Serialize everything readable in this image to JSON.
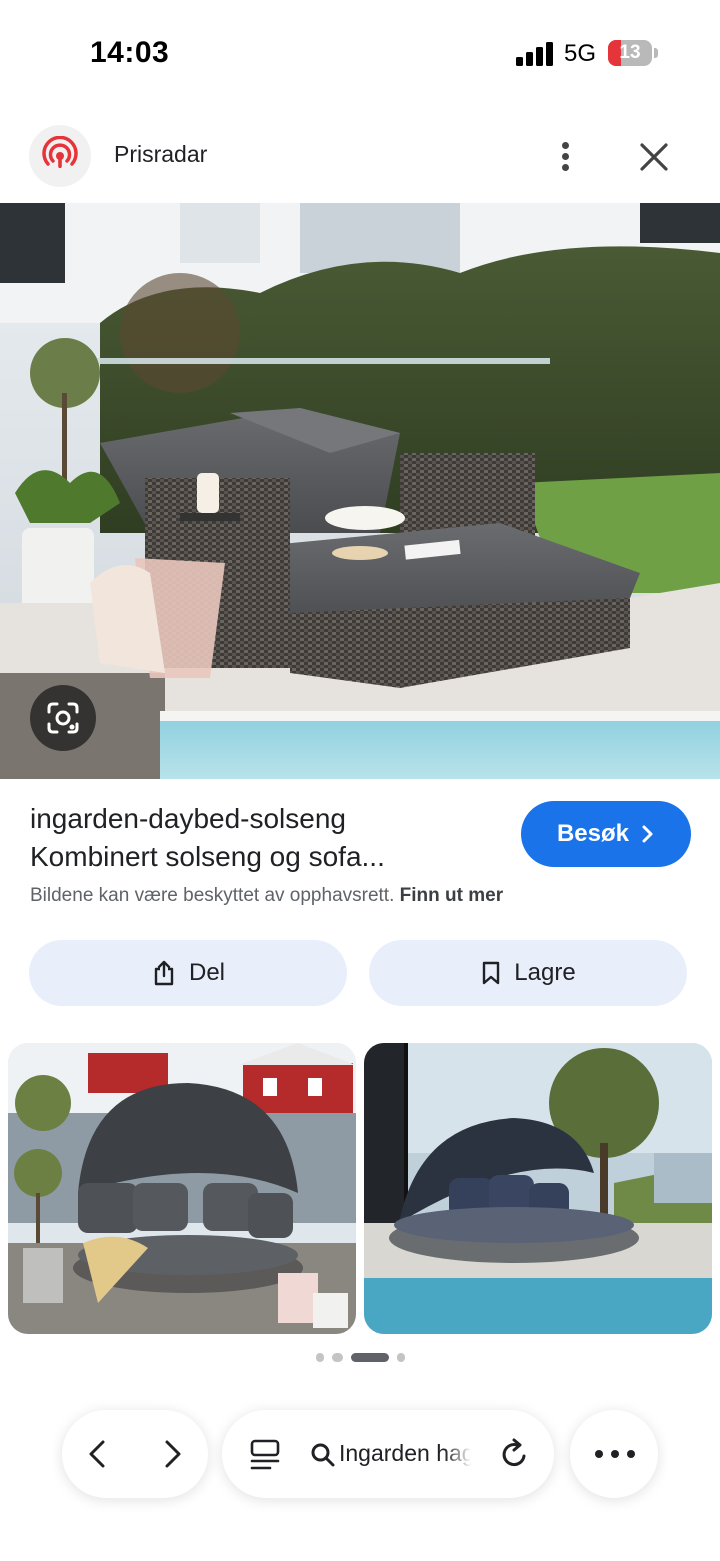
{
  "status_bar": {
    "time": "14:03",
    "network": "5G",
    "battery_level": "13"
  },
  "header": {
    "site_name": "Prisradar",
    "logo_icon": "prisradar-logo",
    "menu_icon": "more-vert-icon",
    "close_icon": "close-icon"
  },
  "main_image": {
    "description_icon": "lens-icon"
  },
  "result": {
    "title_line1": "ingarden-daybed-solseng",
    "title_line2": "Kombinert solseng og sofa...",
    "visit_label": "Besøk",
    "copyright_text": "Bildene kan være beskyttet av opphavsrett.",
    "learn_more": "Finn ut mer"
  },
  "actions": {
    "share_label": "Del",
    "save_label": "Lagre"
  },
  "carousel": {
    "page_count": 4,
    "active_index": 2
  },
  "bottom_bar": {
    "search_text": "Ingarden hage"
  },
  "colors": {
    "accent": "#1a73e8",
    "action_bg": "#e8eefa",
    "logo_red": "#e5343a"
  }
}
